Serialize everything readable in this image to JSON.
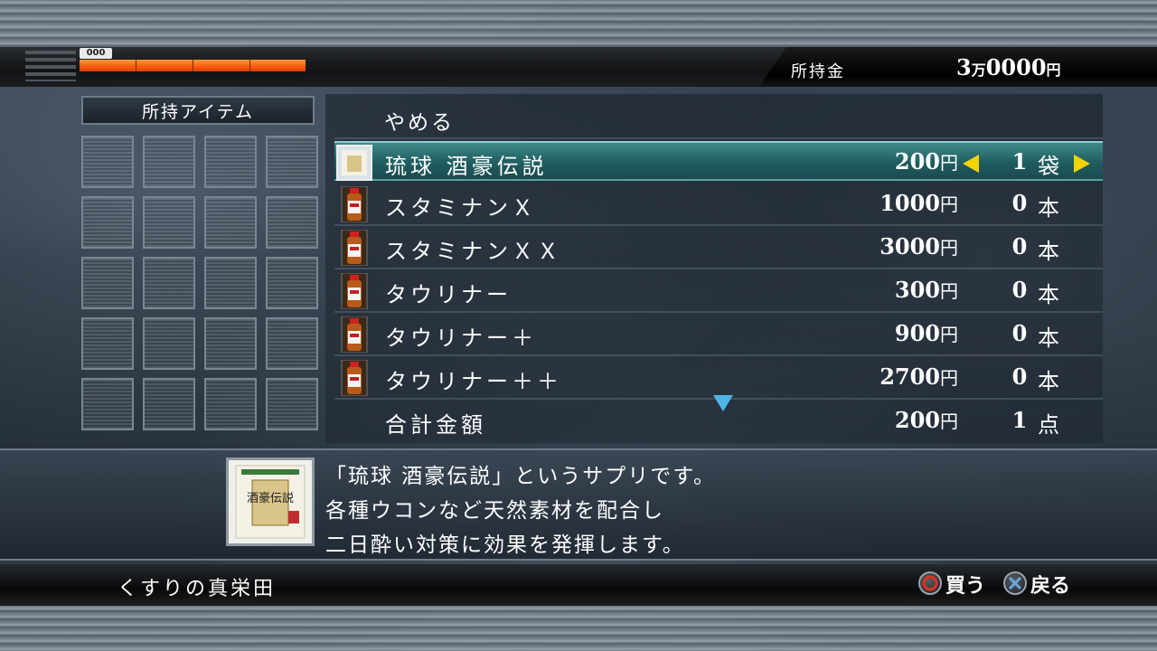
{
  "status": {
    "health_counter": "000",
    "health_level": 1.0,
    "money_label": "所持金",
    "money_man": "3",
    "money_man_unit": "万",
    "money_rest": "0000",
    "money_unit": "円"
  },
  "inventory": {
    "title": "所持アイテム",
    "slots": 20
  },
  "shop": {
    "cancel_label": "やめる",
    "items": [
      {
        "name": "琉球 酒豪伝説",
        "price": "200",
        "yen": "円",
        "qty": "1",
        "unit": "袋",
        "selected": true,
        "icon": "sachet-icon"
      },
      {
        "name": "スタミナンＸ",
        "price": "1000",
        "yen": "円",
        "qty": "0",
        "unit": "本",
        "selected": false,
        "icon": "bottle-icon"
      },
      {
        "name": "スタミナンＸＸ",
        "price": "3000",
        "yen": "円",
        "qty": "0",
        "unit": "本",
        "selected": false,
        "icon": "bottle-icon"
      },
      {
        "name": "タウリナー",
        "price": "300",
        "yen": "円",
        "qty": "0",
        "unit": "本",
        "selected": false,
        "icon": "bottle-icon"
      },
      {
        "name": "タウリナー＋",
        "price": "900",
        "yen": "円",
        "qty": "0",
        "unit": "本",
        "selected": false,
        "icon": "bottle-icon"
      },
      {
        "name": "タウリナー＋＋",
        "price": "2700",
        "yen": "円",
        "qty": "0",
        "unit": "本",
        "selected": false,
        "icon": "bottle-icon"
      }
    ],
    "total": {
      "label": "合計金額",
      "price": "200",
      "yen": "円",
      "qty": "1",
      "unit": "点"
    }
  },
  "description": {
    "lines": [
      "「琉球 酒豪伝説」というサプリです。",
      "各種ウコンなど天然素材を配合し",
      "二日酔い対策に効果を発揮します。"
    ],
    "thumb_text": "酒豪伝説"
  },
  "footer": {
    "shop_name": "くすりの真栄田",
    "buy_label": "買う",
    "back_label": "戻る"
  },
  "colors": {
    "accent_teal": "#2f7779",
    "arrow_yellow": "#f2d400",
    "scroll_arrow_blue": "#4fb4e8",
    "health_orange": "#ff6a14",
    "circle_button_red": "#e03020",
    "cross_button_blue": "#4a90d0"
  }
}
